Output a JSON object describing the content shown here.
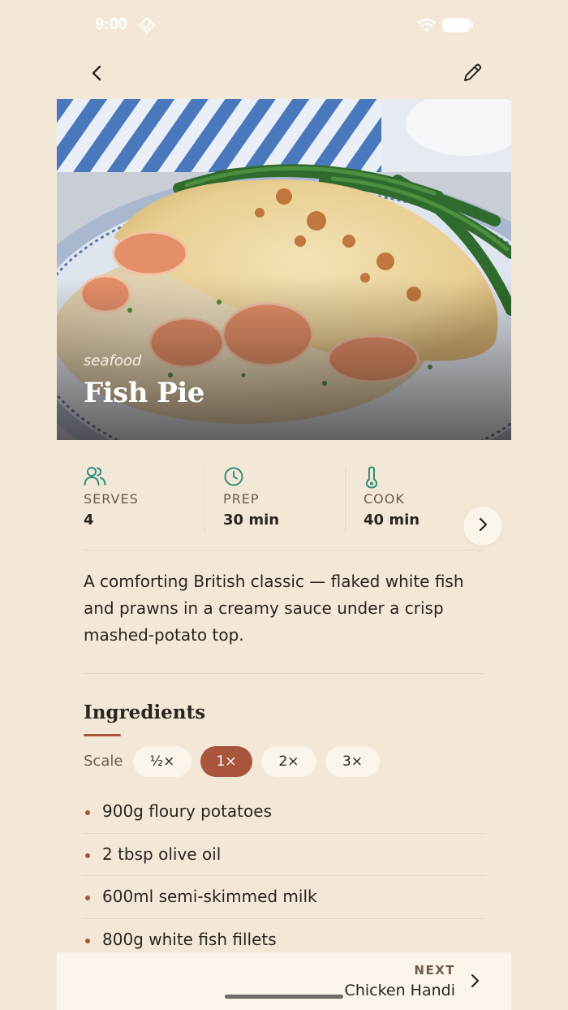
{
  "status_bar": {
    "time": "9:00"
  },
  "recipe": {
    "category": "seafood",
    "title": "Fish Pie",
    "description": "A comforting British classic — flaked white fish and prawns in a creamy sauce under a crisp mashed-potato top."
  },
  "stats": [
    {
      "label": "SERVES",
      "value": "4",
      "icon": "people-icon"
    },
    {
      "label": "PREP",
      "value": "30 min",
      "icon": "clock-icon"
    },
    {
      "label": "COOK",
      "value": "40 min",
      "icon": "thermometer-icon"
    }
  ],
  "ingredients_section": {
    "title": "Ingredients",
    "scale_label": "Scale",
    "scale_options": [
      "½×",
      "1×",
      "2×",
      "3×"
    ],
    "selected_scale": "1×",
    "items": [
      "900g floury potatoes",
      "2 tbsp olive oil",
      "600ml semi-skimmed milk",
      "800g white fish fillets"
    ]
  },
  "next_recipe": {
    "kicker": "NEXT",
    "title": "Chicken Handi"
  },
  "colors": {
    "background": "#f3e8d8",
    "accent": "#a9553b",
    "icon_teal": "#2f8f7a",
    "card": "#fbf4ea"
  }
}
